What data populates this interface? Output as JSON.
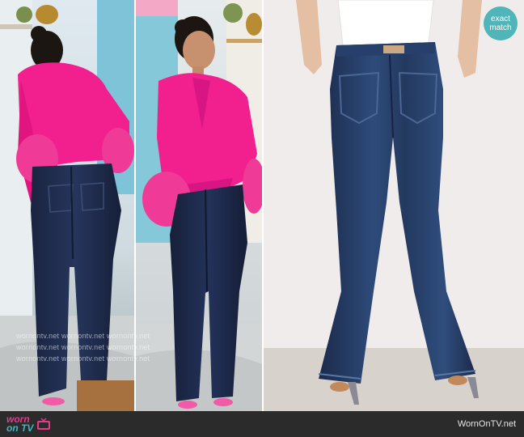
{
  "badge": {
    "line1": "exact",
    "line2": "match"
  },
  "footer": {
    "logo_top": "worn",
    "logo_bottom": "on TV",
    "site": "WornOnTV.net"
  },
  "watermark": {
    "text": "wornontv.net  wornontv.net  wornontv.net"
  },
  "colors": {
    "blazer_pink": "#f21f8f",
    "denim_dark": "#1e2a45",
    "denim_mid": "#2c4a78",
    "badge_teal": "#4fb5b8",
    "footer_bg": "#2b2b2b",
    "logo_pink": "#e53a8b",
    "logo_teal": "#3fb7c4"
  },
  "icons": {
    "tv": "tv-icon"
  }
}
